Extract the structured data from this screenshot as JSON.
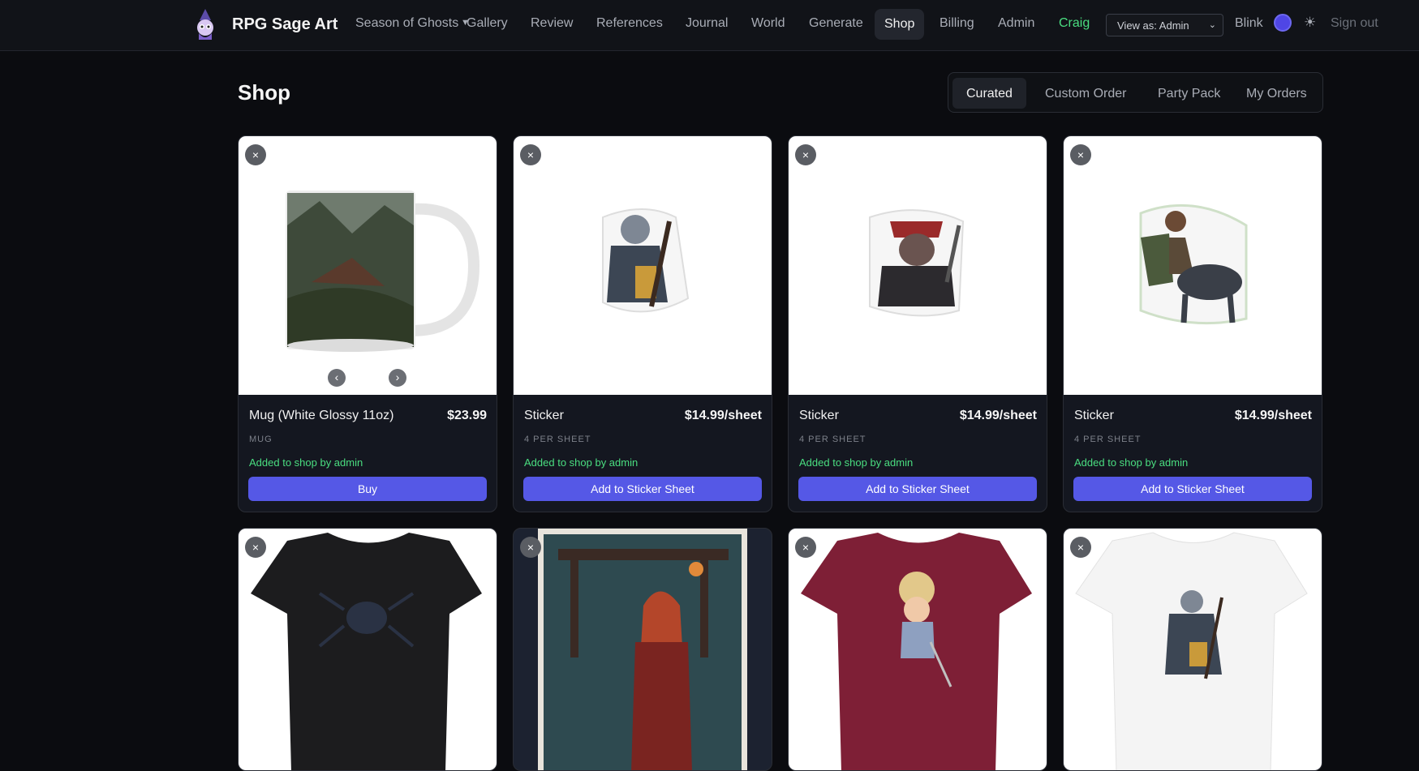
{
  "nav": {
    "brand": "RPG Sage Art",
    "campaign": "Season of Ghosts",
    "items": [
      "Gallery",
      "Review",
      "References",
      "Journal",
      "World",
      "Generate",
      "Shop",
      "Billing",
      "Admin"
    ],
    "active": "Shop",
    "user": "Craig",
    "view_as": "View as: Admin",
    "blink": "Blink",
    "sign_out": "Sign out",
    "accent_color": "#4f46e5",
    "user_color": "#4ade80"
  },
  "page": {
    "title": "Shop",
    "tabs": [
      "Curated",
      "Custom Order",
      "Party Pack",
      "My Orders"
    ],
    "active_tab": "Curated"
  },
  "products": [
    {
      "name": "Mug (White Glossy 11oz)",
      "price": "$23.99",
      "subtitle": "MUG",
      "added": "Added to shop by admin",
      "action": "Buy",
      "image": "mug-forest-art"
    },
    {
      "name": "Sticker",
      "price": "$14.99/sheet",
      "subtitle": "4 PER SHEET",
      "added": "Added to shop by admin",
      "action": "Add to Sticker Sheet",
      "image": "sticker-grey-mage"
    },
    {
      "name": "Sticker",
      "price": "$14.99/sheet",
      "subtitle": "4 PER SHEET",
      "added": "Added to shop by admin",
      "action": "Add to Sticker Sheet",
      "image": "sticker-rat-rogue"
    },
    {
      "name": "Sticker",
      "price": "$14.99/sheet",
      "subtitle": "4 PER SHEET",
      "added": "Added to shop by admin",
      "action": "Add to Sticker Sheet",
      "image": "sticker-centaur-knight"
    }
  ],
  "products_row2": [
    {
      "image": "tshirt-black-spider"
    },
    {
      "image": "poster-blue-archer"
    },
    {
      "image": "tshirt-maroon-doll"
    },
    {
      "image": "tshirt-white-mage"
    }
  ],
  "icons": {
    "close": "×",
    "prev": "‹",
    "next": "›",
    "sun": "☀"
  }
}
